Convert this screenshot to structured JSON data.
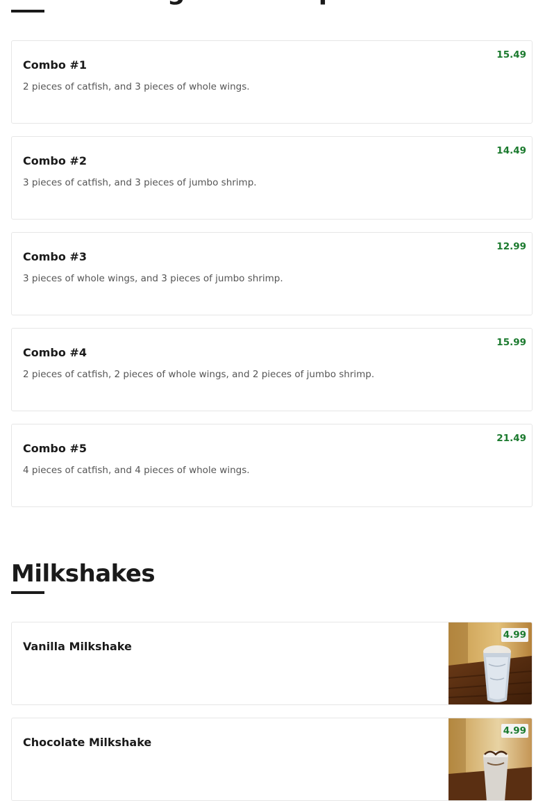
{
  "previous_section": {
    "title": "Combo Wings & Shrimp"
  },
  "combos": [
    {
      "name": "Combo #1",
      "description": "2 pieces of catfish, and 3 pieces of whole wings.",
      "price": "15.49"
    },
    {
      "name": "Combo #2",
      "description": "3 pieces of catfish, and 3 pieces of jumbo shrimp.",
      "price": "14.49"
    },
    {
      "name": "Combo #3",
      "description": "3 pieces of whole wings, and 3 pieces of jumbo shrimp.",
      "price": "12.99"
    },
    {
      "name": "Combo #4",
      "description": "2 pieces of catfish, 2 pieces of whole wings, and 2 pieces of jumbo shrimp.",
      "price": "15.99"
    },
    {
      "name": "Combo #5",
      "description": "4 pieces of catfish, and 4 pieces of whole wings.",
      "price": "21.49"
    }
  ],
  "milkshakes": {
    "title": "Milkshakes",
    "items": [
      {
        "name": "Vanilla Milkshake",
        "price": "4.99"
      },
      {
        "name": "Chocolate Milkshake",
        "price": "4.99"
      }
    ]
  },
  "colors": {
    "price_green": "#1b7a2e",
    "text_dark": "#1a1a1a",
    "text_muted": "#555555",
    "card_border": "#e6e6e6"
  }
}
